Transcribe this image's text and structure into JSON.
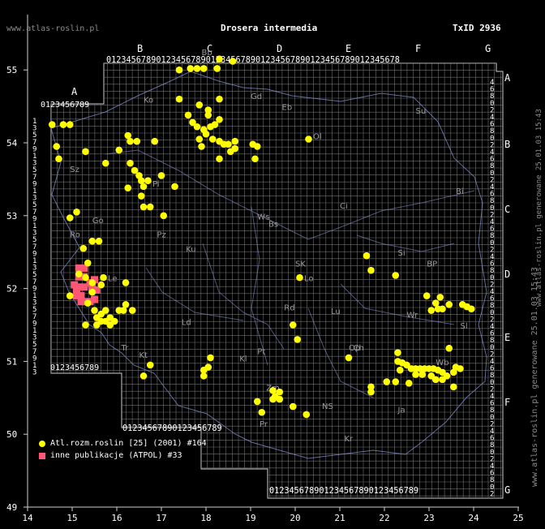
{
  "header": {
    "site": "www.atlas-roslin.pl",
    "title": "Drosera intermedia",
    "taxon_id": "TxID 2936"
  },
  "footer": {
    "vertical_left": "www.atlas-roslin.pl generowane 25.01.03 15:43",
    "vertical_right": "www.atlas-roslin.pl generowane 25.01.03 15:43"
  },
  "axes": {
    "x_ticks": [
      "14",
      "15",
      "16",
      "17",
      "18",
      "19",
      "20",
      "21",
      "22",
      "23",
      "24",
      "25"
    ],
    "y_ticks": [
      "49",
      "50",
      "51",
      "52",
      "53",
      "54",
      "55"
    ]
  },
  "grid": {
    "column_letters": [
      "A",
      "B",
      "C",
      "D",
      "E",
      "F",
      "G"
    ],
    "row_letters": [
      "A",
      "B",
      "C",
      "D",
      "E",
      "F",
      "G"
    ],
    "digits": "0123456789",
    "region_codes": [
      "Ko",
      "Gd",
      "Eb",
      "Ol",
      "Su",
      "Sz",
      "Pi",
      "Ci",
      "Bi",
      "Go",
      "Ws",
      "Bs",
      "Ro",
      "Pz",
      "Ku",
      "SK",
      "Si",
      "BP",
      "Le",
      "Lo",
      "Wr",
      "Ld",
      "Pt",
      "Rd",
      "Lu",
      "Op",
      "Kt",
      "Kl",
      "Zm",
      "Ch",
      "Wb",
      "Sl",
      "Tr",
      "Bb",
      "NS",
      "Pr",
      "Kr",
      "Ja"
    ]
  },
  "legend": [
    {
      "marker": "circle",
      "color": "#ffff00",
      "label": "Atl.rozm.roslin [25] (2001) #164"
    },
    {
      "marker": "square",
      "color": "#ff5577",
      "label": "inne publikacje (ATPOL) #33"
    }
  ],
  "points_yellow": [
    [
      14.55,
      54.25
    ],
    [
      14.8,
      54.25
    ],
    [
      14.95,
      54.25
    ],
    [
      14.65,
      53.95
    ],
    [
      14.7,
      53.78
    ],
    [
      15.3,
      53.88
    ],
    [
      16.05,
      53.9
    ],
    [
      15.75,
      53.72
    ],
    [
      16.25,
      54.1
    ],
    [
      16.3,
      54.02
    ],
    [
      16.45,
      54.02
    ],
    [
      16.85,
      54.02
    ],
    [
      16.3,
      53.72
    ],
    [
      16.4,
      53.62
    ],
    [
      16.5,
      53.55
    ],
    [
      16.55,
      53.48
    ],
    [
      16.7,
      53.48
    ],
    [
      16.6,
      53.4
    ],
    [
      16.25,
      53.38
    ],
    [
      16.55,
      53.27
    ],
    [
      16.6,
      53.12
    ],
    [
      16.75,
      53.12
    ],
    [
      17.0,
      53.55
    ],
    [
      17.3,
      53.4
    ],
    [
      17.05,
      53.0
    ],
    [
      14.95,
      52.97
    ],
    [
      15.1,
      53.05
    ],
    [
      15.25,
      52.55
    ],
    [
      15.45,
      52.65
    ],
    [
      15.6,
      52.65
    ],
    [
      15.35,
      52.35
    ],
    [
      17.4,
      55.0
    ],
    [
      17.65,
      55.02
    ],
    [
      17.8,
      55.02
    ],
    [
      17.95,
      55.02
    ],
    [
      18.25,
      55.02
    ],
    [
      18.6,
      55.12
    ],
    [
      18.3,
      55.15
    ],
    [
      17.4,
      54.6
    ],
    [
      17.85,
      54.52
    ],
    [
      18.05,
      54.45
    ],
    [
      18.3,
      54.6
    ],
    [
      18.05,
      54.38
    ],
    [
      17.6,
      54.38
    ],
    [
      17.7,
      54.28
    ],
    [
      17.8,
      54.22
    ],
    [
      17.95,
      54.18
    ],
    [
      17.85,
      54.05
    ],
    [
      17.9,
      53.95
    ],
    [
      18.0,
      54.12
    ],
    [
      18.1,
      54.22
    ],
    [
      18.2,
      54.25
    ],
    [
      18.3,
      54.32
    ],
    [
      18.15,
      54.05
    ],
    [
      18.3,
      54.02
    ],
    [
      18.4,
      53.98
    ],
    [
      18.5,
      53.98
    ],
    [
      18.55,
      53.88
    ],
    [
      18.65,
      53.92
    ],
    [
      18.3,
      53.78
    ],
    [
      18.65,
      54.02
    ],
    [
      19.05,
      53.98
    ],
    [
      19.15,
      53.95
    ],
    [
      19.1,
      53.78
    ],
    [
      20.3,
      54.05
    ],
    [
      15.15,
      52.2
    ],
    [
      15.3,
      52.15
    ],
    [
      15.45,
      52.08
    ],
    [
      15.65,
      52.05
    ],
    [
      15.7,
      52.15
    ],
    [
      15.45,
      51.95
    ],
    [
      15.35,
      51.8
    ],
    [
      15.5,
      51.7
    ],
    [
      15.55,
      51.6
    ],
    [
      15.55,
      51.5
    ],
    [
      15.65,
      51.55
    ],
    [
      15.75,
      51.55
    ],
    [
      15.85,
      51.5
    ],
    [
      15.65,
      51.65
    ],
    [
      15.75,
      51.7
    ],
    [
      15.85,
      51.6
    ],
    [
      15.95,
      51.55
    ],
    [
      16.05,
      51.7
    ],
    [
      16.15,
      51.7
    ],
    [
      16.2,
      51.78
    ],
    [
      15.3,
      51.5
    ],
    [
      16.2,
      52.08
    ],
    [
      14.95,
      51.9
    ],
    [
      16.75,
      50.95
    ],
    [
      16.6,
      50.8
    ],
    [
      18.1,
      51.05
    ],
    [
      18.05,
      50.92
    ],
    [
      17.95,
      50.88
    ],
    [
      17.95,
      50.8
    ],
    [
      19.15,
      50.45
    ],
    [
      19.25,
      50.3
    ],
    [
      19.5,
      50.6
    ],
    [
      19.55,
      50.52
    ],
    [
      19.65,
      50.58
    ],
    [
      19.5,
      50.48
    ],
    [
      19.65,
      50.48
    ],
    [
      19.95,
      50.38
    ],
    [
      20.25,
      50.27
    ],
    [
      20.05,
      51.3
    ],
    [
      19.95,
      51.5
    ],
    [
      20.1,
      52.15
    ],
    [
      21.2,
      51.05
    ],
    [
      21.6,
      52.45
    ],
    [
      21.7,
      52.25
    ],
    [
      22.25,
      52.18
    ],
    [
      22.95,
      51.9
    ],
    [
      23.05,
      51.7
    ],
    [
      23.2,
      51.72
    ],
    [
      23.15,
      51.8
    ],
    [
      23.25,
      51.88
    ],
    [
      23.3,
      51.72
    ],
    [
      23.45,
      51.78
    ],
    [
      23.75,
      51.78
    ],
    [
      23.85,
      51.75
    ],
    [
      23.95,
      51.72
    ],
    [
      23.45,
      51.18
    ],
    [
      22.3,
      51.12
    ],
    [
      22.3,
      51.0
    ],
    [
      22.35,
      50.88
    ],
    [
      22.4,
      50.98
    ],
    [
      22.5,
      50.95
    ],
    [
      22.6,
      50.9
    ],
    [
      22.7,
      50.9
    ],
    [
      22.8,
      50.9
    ],
    [
      22.9,
      50.9
    ],
    [
      23.0,
      50.9
    ],
    [
      23.1,
      50.9
    ],
    [
      23.2,
      50.88
    ],
    [
      23.3,
      50.85
    ],
    [
      23.4,
      50.8
    ],
    [
      23.55,
      50.85
    ],
    [
      23.6,
      50.92
    ],
    [
      23.7,
      50.9
    ],
    [
      22.7,
      50.82
    ],
    [
      22.85,
      50.82
    ],
    [
      23.05,
      50.8
    ],
    [
      23.15,
      50.75
    ],
    [
      23.3,
      50.75
    ],
    [
      23.55,
      50.65
    ],
    [
      22.05,
      50.72
    ],
    [
      22.25,
      50.72
    ],
    [
      22.55,
      50.7
    ],
    [
      21.7,
      50.65
    ],
    [
      21.7,
      50.58
    ],
    [
      16.35,
      51.7
    ]
  ],
  "points_pink": [
    [
      15.15,
      52.28
    ],
    [
      15.27,
      52.28
    ],
    [
      15.15,
      52.16
    ],
    [
      15.27,
      52.16
    ],
    [
      15.05,
      52.05
    ],
    [
      15.15,
      52.02
    ],
    [
      15.27,
      52.02
    ],
    [
      15.1,
      51.9
    ],
    [
      15.2,
      51.9
    ],
    [
      15.2,
      51.82
    ],
    [
      15.3,
      51.82
    ],
    [
      15.4,
      51.82
    ],
    [
      15.5,
      51.85
    ],
    [
      15.45,
      52.02
    ],
    [
      15.5,
      52.12
    ],
    [
      15.4,
      52.08
    ],
    [
      15.55,
      51.98
    ],
    [
      15.1,
      51.98
    ]
  ]
}
